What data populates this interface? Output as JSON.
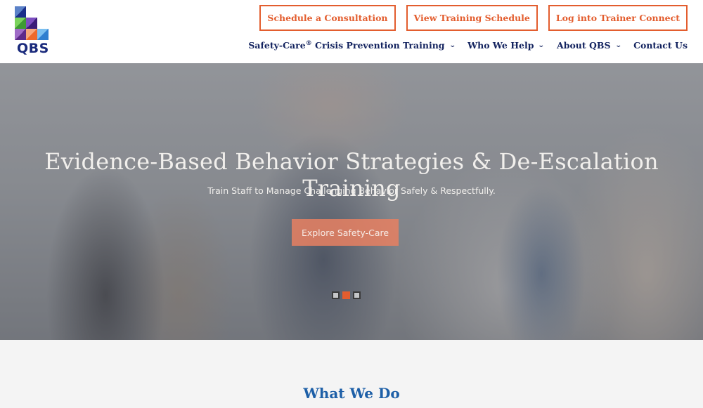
{
  "brand": {
    "logo_text": "QBS",
    "logo_colors": {
      "top": "#2f5fb0",
      "mid_left": "#5cc04a",
      "mid_right": "#5a2e9c",
      "bottom_left": "#7b3fa6",
      "bottom_mid": "#f07a3c",
      "bottom_right": "#4a9ae0"
    }
  },
  "header": {
    "cta_buttons": [
      {
        "label": "Schedule a Consultation"
      },
      {
        "label": "View Training Schedule"
      },
      {
        "label": "Log into Trainer Connect"
      }
    ],
    "nav": [
      {
        "label": "Safety-Care",
        "sup": "®",
        "label_after": " Crisis Prevention Training",
        "dropdown": true
      },
      {
        "label": "Who We Help",
        "dropdown": true
      },
      {
        "label": "About QBS",
        "dropdown": true
      },
      {
        "label": "Contact Us",
        "dropdown": false
      }
    ],
    "chevron_glyph": "⌄"
  },
  "hero": {
    "title": "Evidence-Based Behavior Strategies & De-Escalation Training",
    "subtitle": "Train Staff to Manage Challenging Behavior Safely & Respectfully.",
    "button_label": "Explore Safety-Care",
    "slides": 3,
    "active_slide": 2
  },
  "section": {
    "title": "What We Do"
  },
  "colors": {
    "accent": "#e35d2e",
    "nav_text": "#13235f",
    "section_title": "#1d5fa7"
  }
}
